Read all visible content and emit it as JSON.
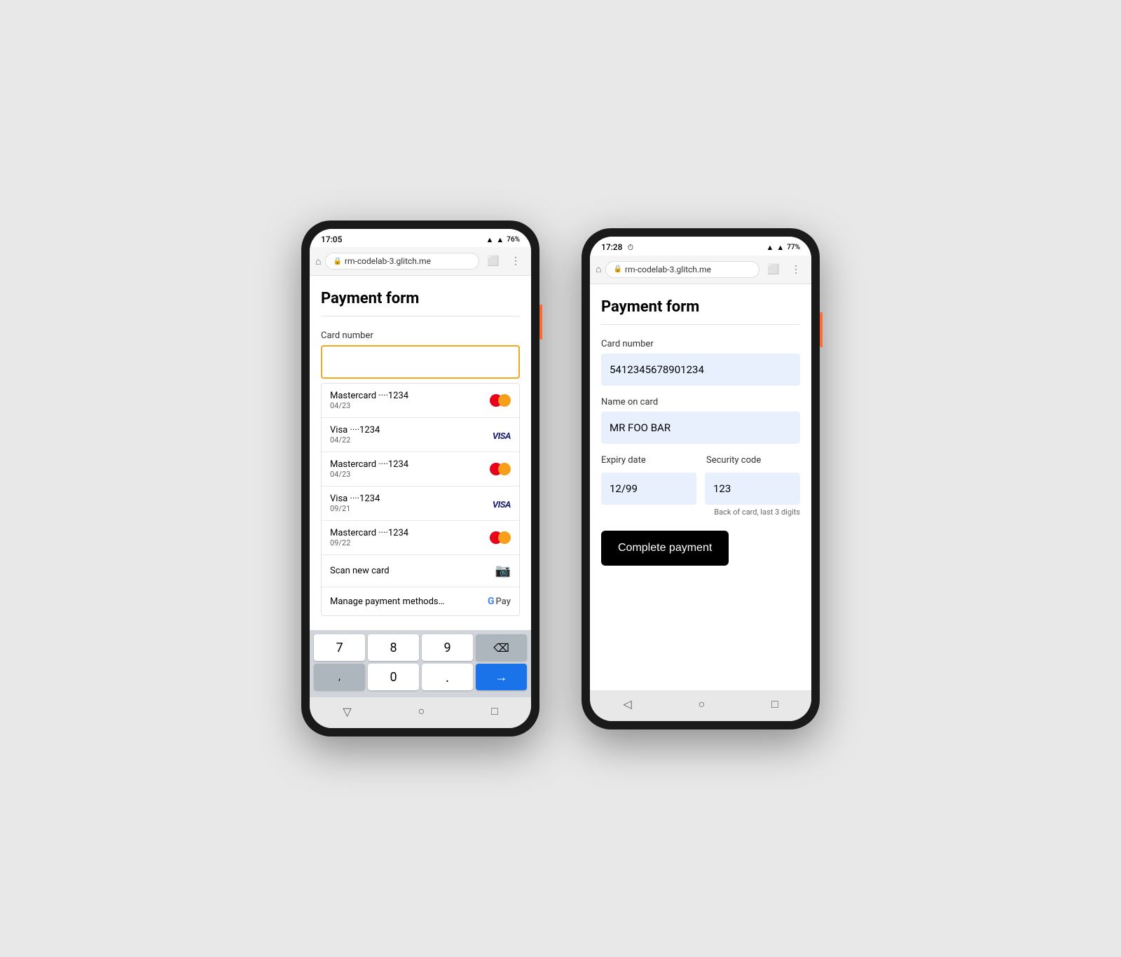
{
  "colors": {
    "accent_orange": "#f5a623",
    "accent_blue": "#1a73e8",
    "input_bg": "#e8f0fe",
    "visa_blue": "#1a1f71",
    "text_dark": "#000000",
    "text_muted": "#666666",
    "divider": "#e0e0e0"
  },
  "phone_left": {
    "status_time": "17:05",
    "status_battery": "76%",
    "browser_url": "rm-codelab-3.glitch.me",
    "page_title": "Payment form",
    "card_number_label": "Card number",
    "card_input_placeholder": "",
    "autocomplete_items": [
      {
        "brand": "Mastercard",
        "dots": "····1234",
        "expiry": "04/23",
        "type": "mastercard"
      },
      {
        "brand": "Visa",
        "dots": "····1234",
        "expiry": "04/22",
        "type": "visa"
      },
      {
        "brand": "Mastercard",
        "dots": "····1234",
        "expiry": "04/23",
        "type": "mastercard"
      },
      {
        "brand": "Visa",
        "dots": "····1234",
        "expiry": "09/21",
        "type": "visa"
      },
      {
        "brand": "Mastercard",
        "dots": "····1234",
        "expiry": "09/22",
        "type": "mastercard"
      }
    ],
    "scan_label": "Scan new card",
    "manage_label": "Manage payment methods…",
    "keyboard_rows": [
      [
        "7",
        "8",
        "9",
        "⌫"
      ],
      [
        ",",
        "0",
        ".",
        "→"
      ]
    ]
  },
  "phone_right": {
    "status_time": "17:28",
    "status_battery": "77%",
    "browser_url": "rm-codelab-3.glitch.me",
    "page_title": "Payment form",
    "card_number_label": "Card number",
    "card_number_value": "5412345678901234",
    "name_label": "Name on card",
    "name_value": "MR FOO BAR",
    "expiry_label": "Expiry date",
    "expiry_value": "12/99",
    "security_label": "Security code",
    "security_value": "123",
    "security_hint": "Back of card, last 3 digits",
    "complete_btn_label": "Complete payment"
  }
}
